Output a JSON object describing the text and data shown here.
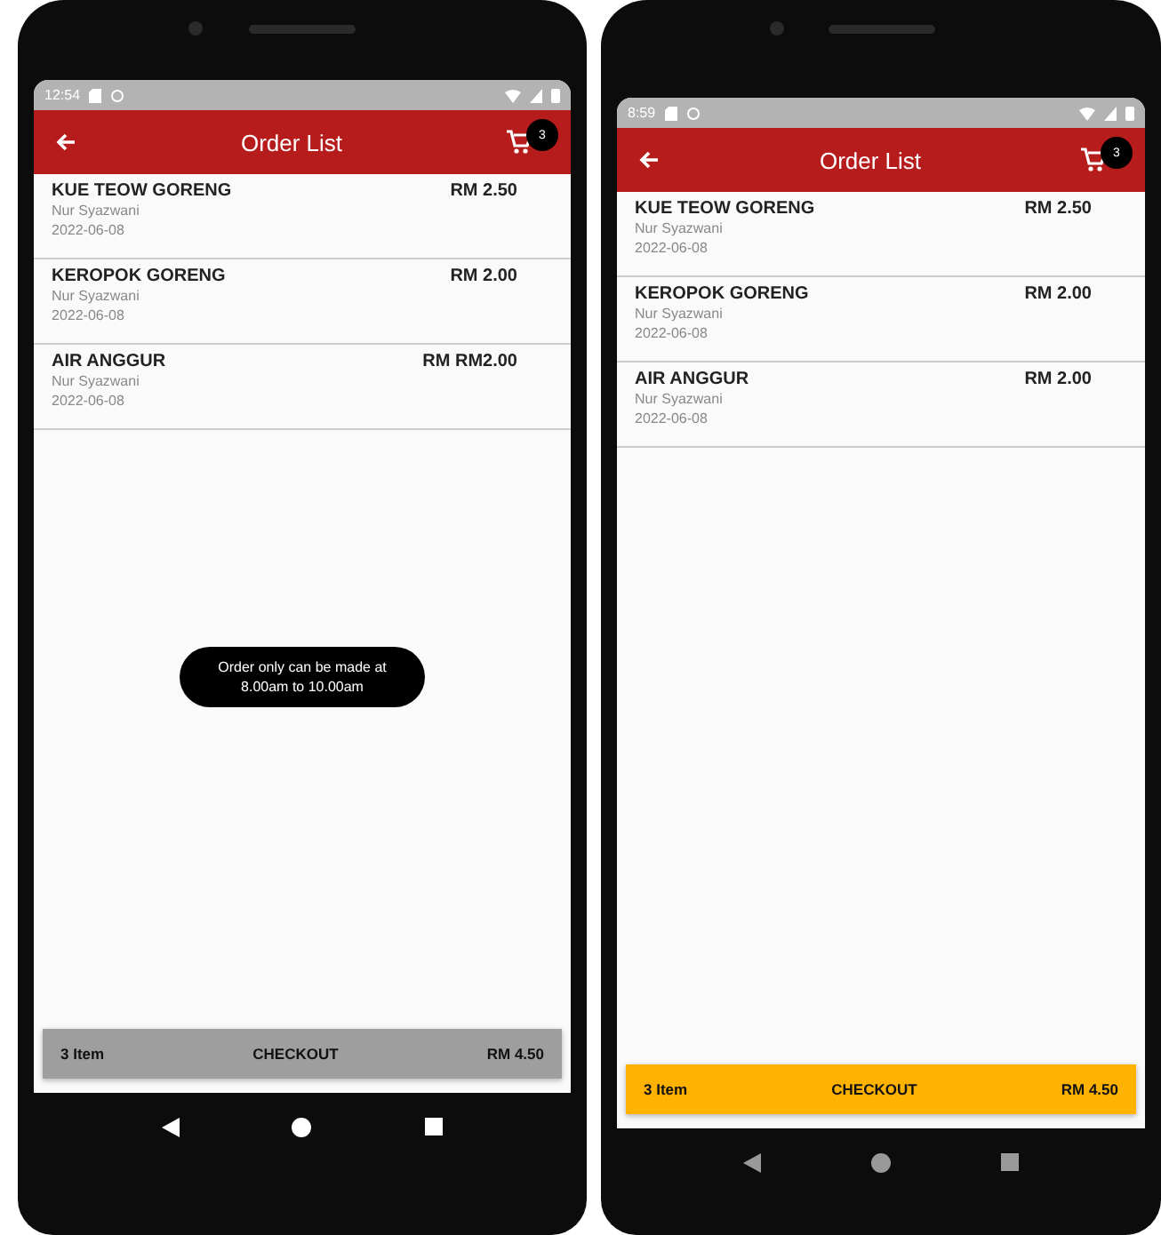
{
  "phones": [
    {
      "status_time": "12:54",
      "title": "Order List",
      "cart_count": "3",
      "orders": [
        {
          "name": "KUE TEOW GORENG",
          "price": "RM 2.50",
          "seller": "Nur Syazwani",
          "date": "2022-06-08"
        },
        {
          "name": "KEROPOK GORENG",
          "price": "RM 2.00",
          "seller": "Nur Syazwani",
          "date": "2022-06-08"
        },
        {
          "name": "AIR ANGGUR",
          "price": "RM RM2.00",
          "seller": "Nur Syazwani",
          "date": "2022-06-08"
        }
      ],
      "toast": "Order only can be made at 8.00am to 10.00am",
      "checkout": {
        "count": "3 Item",
        "label": "CHECKOUT",
        "total": "RM 4.50",
        "disabled": true
      }
    },
    {
      "status_time": "8:59",
      "title": "Order List",
      "cart_count": "3",
      "orders": [
        {
          "name": "KUE TEOW GORENG",
          "price": "RM 2.50",
          "seller": "Nur Syazwani",
          "date": "2022-06-08"
        },
        {
          "name": "KEROPOK GORENG",
          "price": "RM 2.00",
          "seller": "Nur Syazwani",
          "date": "2022-06-08"
        },
        {
          "name": "AIR ANGGUR",
          "price": "RM 2.00",
          "seller": "Nur Syazwani",
          "date": "2022-06-08"
        }
      ],
      "checkout": {
        "count": "3 Item",
        "label": "CHECKOUT",
        "total": "RM 4.50",
        "disabled": false
      }
    }
  ]
}
